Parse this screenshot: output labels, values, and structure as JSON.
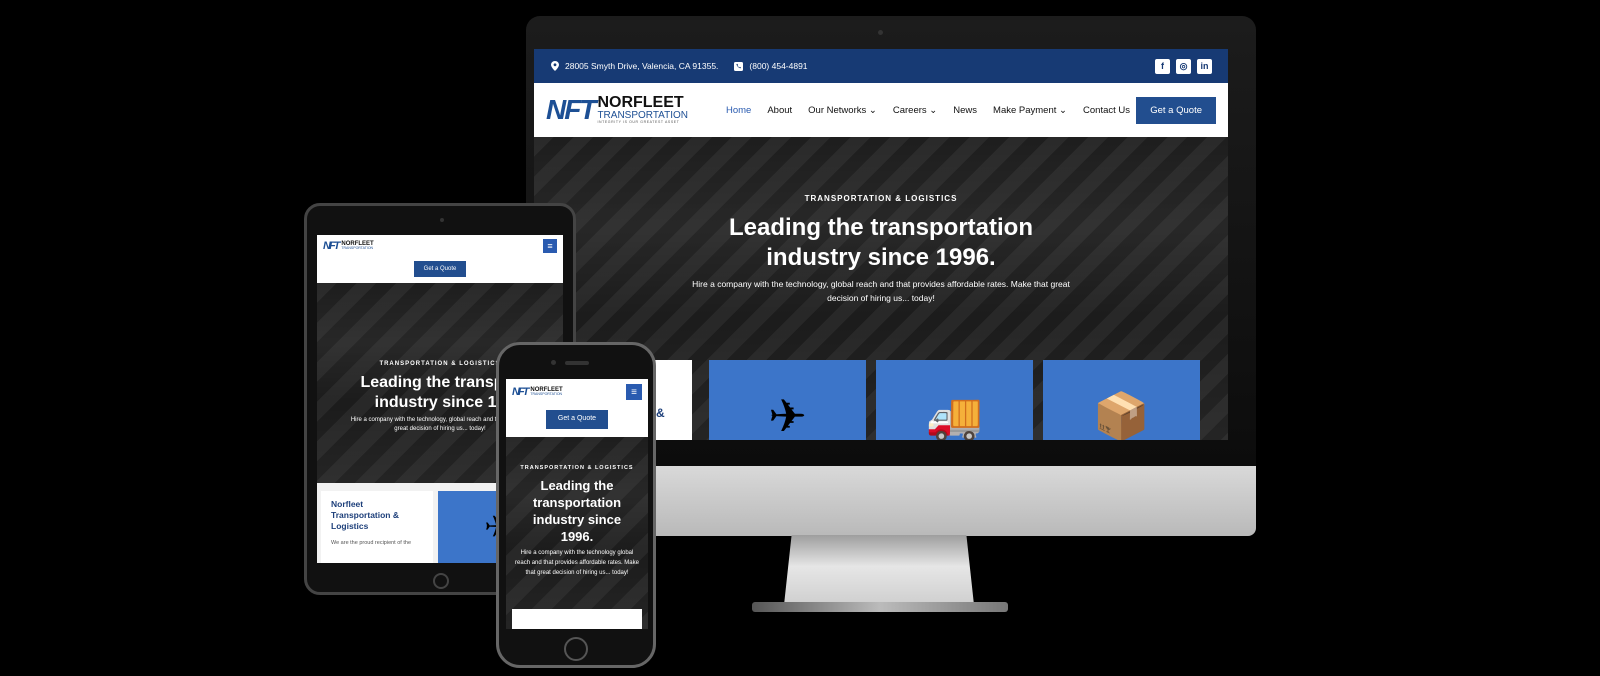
{
  "site": {
    "topbar": {
      "address": "28005 Smyth Drive, Valencia, CA 91355.",
      "phone": "(800) 454-4891",
      "social": [
        "facebook-icon",
        "instagram-icon",
        "linkedin-icon"
      ]
    },
    "logo": {
      "mark": "NFT",
      "name": "NORFLEET",
      "sub": "TRANSPORTATION",
      "tagline": "INTEGRITY IS OUR GREATEST ASSET"
    },
    "nav": {
      "items": [
        "Home",
        "About",
        "Our Networks",
        "Careers",
        "News",
        "Make Payment",
        "Contact Us"
      ],
      "dropdown_caret": "⌄"
    },
    "cta_label": "Get a Quote",
    "hero": {
      "eyebrow": "TRANSPORTATION & LOGISTICS",
      "title": "Leading the transportation industry since 1996.",
      "tablet_title": "Leading the transpor industry since 19",
      "body": "Hire a company with the technology, global reach and that provides affordable rates. Make that great decision of hiring us... today!",
      "tablet_body": "Hire a company with the technology, global reach and that provides great decision of hiring us... today!",
      "phone_body": "Hire a company with the technology global reach and that provides affordable rates. Make that great decision of hiring us... today!"
    },
    "cards": {
      "fragment": "&",
      "intro_title": "Norfleet Transportation & Logistics",
      "intro_body": "We are the proud recipient of the",
      "icons": [
        "airplane-icon",
        "delivery-truck-icon",
        "boxes-icon"
      ]
    }
  },
  "colors": {
    "brand_navy": "#173a74",
    "button_blue": "#224e8f",
    "card_blue": "#3c75c9",
    "active_link": "#2a5bb0"
  }
}
